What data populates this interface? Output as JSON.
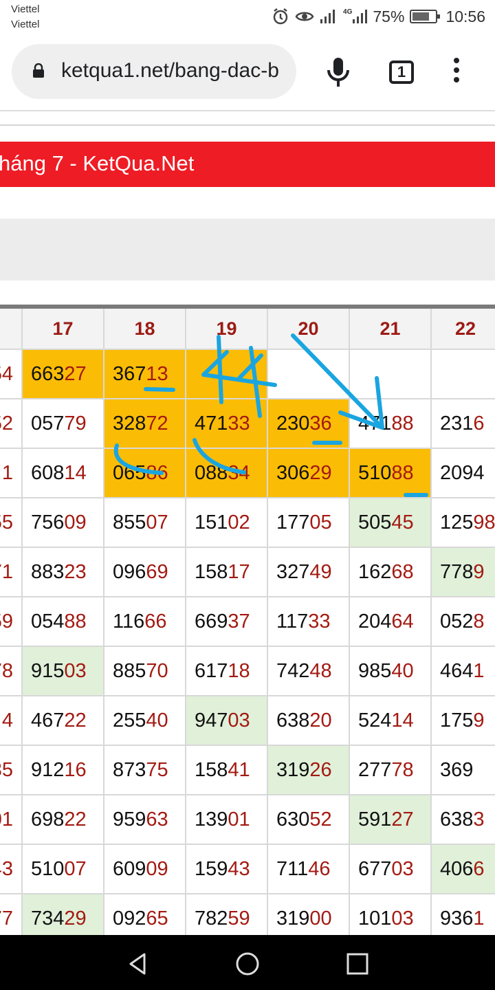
{
  "status_bar": {
    "carrier_1": "Viettel",
    "carrier_2": "Viettel",
    "network": "4G",
    "battery": "75%",
    "battery_level": 0.75,
    "time": "10:56"
  },
  "browser": {
    "url": "ketqua1.net/bang-dac-b",
    "tab_count": "1"
  },
  "banner": {
    "title": "háng 7 - KetQua.Net"
  },
  "table": {
    "header_cut": "",
    "headers": [
      "17",
      "18",
      "19",
      "20",
      "21",
      "22"
    ],
    "left_col": [
      "54",
      "52",
      "1",
      "55",
      "71",
      "59",
      "78",
      "4",
      "35",
      "01",
      "43",
      "77"
    ],
    "rows": [
      [
        {
          "v": "663",
          "t": "27",
          "bg": "orange"
        },
        {
          "v": "367",
          "t": "13",
          "bg": "orange"
        },
        {
          "v": "",
          "t": "",
          "bg": "orange"
        },
        {
          "v": "",
          "t": "",
          "bg": ""
        },
        {
          "v": "",
          "t": "",
          "bg": ""
        },
        {
          "v": "",
          "t": "",
          "bg": ""
        }
      ],
      [
        {
          "v": "057",
          "t": "79",
          "bg": ""
        },
        {
          "v": "328",
          "t": "72",
          "bg": "orange"
        },
        {
          "v": "471",
          "t": "33",
          "bg": "orange"
        },
        {
          "v": "230",
          "t": "36",
          "bg": "orange"
        },
        {
          "v": "471",
          "t": "88",
          "bg": ""
        },
        {
          "v": "231",
          "t": "6",
          "bg": ""
        }
      ],
      [
        {
          "v": "608",
          "t": "14",
          "bg": ""
        },
        {
          "v": "065",
          "t": "86",
          "bg": "orange"
        },
        {
          "v": "088",
          "t": "34",
          "bg": "orange"
        },
        {
          "v": "306",
          "t": "29",
          "bg": "orange"
        },
        {
          "v": "510",
          "t": "88",
          "bg": "orange"
        },
        {
          "v": "2094",
          "t": "",
          "bg": ""
        }
      ],
      [
        {
          "v": "756",
          "t": "09",
          "bg": ""
        },
        {
          "v": "855",
          "t": "07",
          "bg": ""
        },
        {
          "v": "151",
          "t": "02",
          "bg": ""
        },
        {
          "v": "177",
          "t": "05",
          "bg": ""
        },
        {
          "v": "505",
          "t": "45",
          "bg": "green"
        },
        {
          "v": "125",
          "t": "98",
          "bg": ""
        }
      ],
      [
        {
          "v": "883",
          "t": "23",
          "bg": ""
        },
        {
          "v": "096",
          "t": "69",
          "bg": ""
        },
        {
          "v": "158",
          "t": "17",
          "bg": ""
        },
        {
          "v": "327",
          "t": "49",
          "bg": ""
        },
        {
          "v": "162",
          "t": "68",
          "bg": ""
        },
        {
          "v": "778",
          "t": "9",
          "bg": "green"
        }
      ],
      [
        {
          "v": "054",
          "t": "88",
          "bg": ""
        },
        {
          "v": "116",
          "t": "66",
          "bg": ""
        },
        {
          "v": "669",
          "t": "37",
          "bg": ""
        },
        {
          "v": "117",
          "t": "33",
          "bg": ""
        },
        {
          "v": "204",
          "t": "64",
          "bg": ""
        },
        {
          "v": "052",
          "t": "8",
          "bg": ""
        }
      ],
      [
        {
          "v": "915",
          "t": "03",
          "bg": "green"
        },
        {
          "v": "885",
          "t": "70",
          "bg": ""
        },
        {
          "v": "617",
          "t": "18",
          "bg": ""
        },
        {
          "v": "742",
          "t": "48",
          "bg": ""
        },
        {
          "v": "985",
          "t": "40",
          "bg": ""
        },
        {
          "v": "464",
          "t": "1",
          "bg": ""
        }
      ],
      [
        {
          "v": "467",
          "t": "22",
          "bg": ""
        },
        {
          "v": "255",
          "t": "40",
          "bg": ""
        },
        {
          "v": "947",
          "t": "03",
          "bg": "green"
        },
        {
          "v": "638",
          "t": "20",
          "bg": ""
        },
        {
          "v": "524",
          "t": "14",
          "bg": ""
        },
        {
          "v": "175",
          "t": "9",
          "bg": ""
        }
      ],
      [
        {
          "v": "912",
          "t": "16",
          "bg": ""
        },
        {
          "v": "873",
          "t": "75",
          "bg": ""
        },
        {
          "v": "158",
          "t": "41",
          "bg": ""
        },
        {
          "v": "319",
          "t": "26",
          "bg": "green"
        },
        {
          "v": "277",
          "t": "78",
          "bg": ""
        },
        {
          "v": "369",
          "t": "",
          "bg": ""
        }
      ],
      [
        {
          "v": "698",
          "t": "22",
          "bg": ""
        },
        {
          "v": "959",
          "t": "63",
          "bg": ""
        },
        {
          "v": "139",
          "t": "01",
          "bg": ""
        },
        {
          "v": "630",
          "t": "52",
          "bg": ""
        },
        {
          "v": "591",
          "t": "27",
          "bg": "green"
        },
        {
          "v": "638",
          "t": "3",
          "bg": ""
        }
      ],
      [
        {
          "v": "510",
          "t": "07",
          "bg": ""
        },
        {
          "v": "609",
          "t": "09",
          "bg": ""
        },
        {
          "v": "159",
          "t": "43",
          "bg": ""
        },
        {
          "v": "711",
          "t": "46",
          "bg": ""
        },
        {
          "v": "677",
          "t": "03",
          "bg": ""
        },
        {
          "v": "406",
          "t": "6",
          "bg": "green"
        }
      ],
      [
        {
          "v": "734",
          "t": "29",
          "bg": "green"
        },
        {
          "v": "092",
          "t": "65",
          "bg": ""
        },
        {
          "v": "782",
          "t": "59",
          "bg": ""
        },
        {
          "v": "319",
          "t": "00",
          "bg": ""
        },
        {
          "v": "101",
          "t": "03",
          "bg": ""
        },
        {
          "v": "936",
          "t": "1",
          "bg": ""
        }
      ]
    ]
  },
  "annotations": {
    "handwritten_text": "44"
  },
  "colors": {
    "banner_red": "#ee1c25",
    "highlight_orange": "#fbbc05",
    "highlight_green": "#e0f0d9",
    "header_text": "#9b1b14",
    "tail_text": "#a31a12",
    "annotation_blue": "#1aa5e0"
  }
}
